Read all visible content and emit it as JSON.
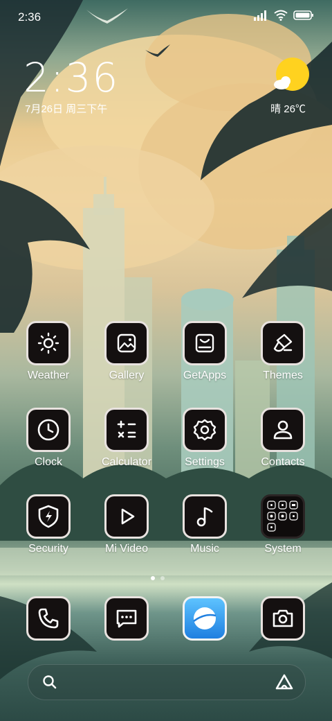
{
  "status_bar": {
    "time": "2:36"
  },
  "clock_widget": {
    "time": "2:36",
    "date": "7月26日 周三下午"
  },
  "weather_widget": {
    "temperature": "晴 26℃"
  },
  "apps": [
    {
      "label": "Weather",
      "icon": "sun-icon"
    },
    {
      "label": "Gallery",
      "icon": "image-icon"
    },
    {
      "label": "GetApps",
      "icon": "store-icon"
    },
    {
      "label": "Themes",
      "icon": "brush-icon"
    },
    {
      "label": "Clock",
      "icon": "clock-icon"
    },
    {
      "label": "Calculator",
      "icon": "calculator-icon"
    },
    {
      "label": "Settings",
      "icon": "gear-icon"
    },
    {
      "label": "Contacts",
      "icon": "person-icon"
    },
    {
      "label": "Security",
      "icon": "shield-bolt-icon"
    },
    {
      "label": "Mi Video",
      "icon": "play-icon"
    },
    {
      "label": "Music",
      "icon": "music-note-icon"
    },
    {
      "label": "System",
      "icon": "folder-grid-icon"
    }
  ],
  "dock": [
    {
      "icon": "phone-icon"
    },
    {
      "icon": "message-icon"
    },
    {
      "icon": "browser-icon"
    },
    {
      "icon": "camera-icon"
    }
  ],
  "pager": {
    "pages": 2,
    "active": 1
  },
  "search_bar": {
    "left_icon": "search-icon",
    "right_icon": "assistant-icon"
  }
}
